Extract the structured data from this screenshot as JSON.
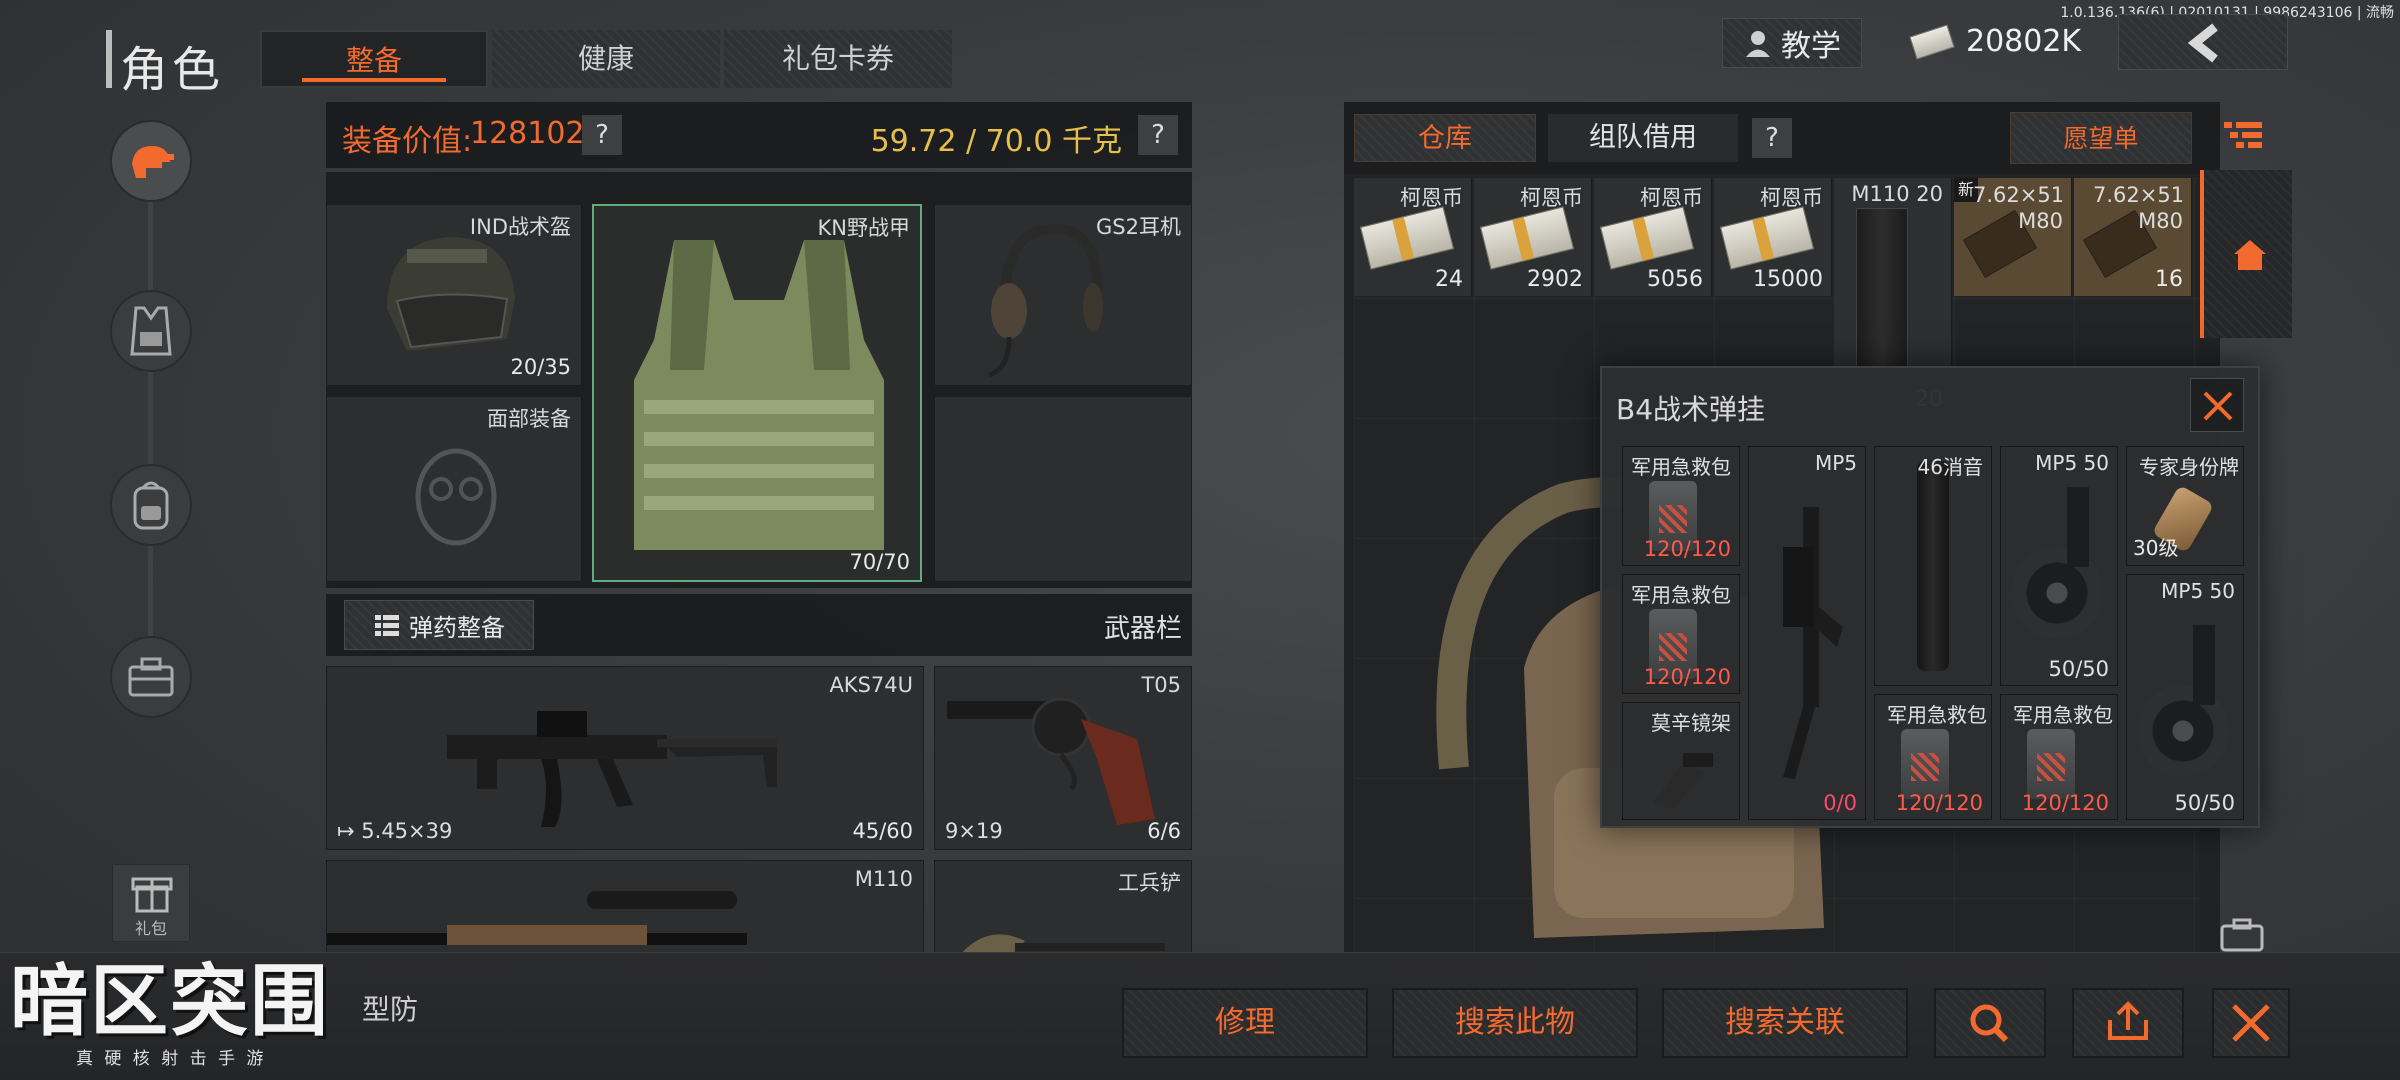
{
  "version": "1.0.136.136(6) | 02010131 | 9986243106 | 流畅",
  "header": {
    "title": "角色",
    "tabs": [
      "整备",
      "健康",
      "礼包卡券"
    ],
    "active_tab": 0,
    "tutorial_label": "教学",
    "currency": "20802K"
  },
  "equipment": {
    "value_label": "装备价值:",
    "value": "128102",
    "help": "?",
    "weight": "59.72 / 70.0 千克",
    "slots": [
      {
        "name": "IND战术盔",
        "count": "20/35"
      },
      {
        "name": "KN野战甲",
        "count": "70/70"
      },
      {
        "name": "GS2耳机",
        "count": ""
      },
      {
        "name": "面部装备",
        "count": ""
      }
    ],
    "ammo_button": "弹药整备",
    "weapons_label": "武器栏",
    "weapons": [
      {
        "name": "AKS74U",
        "ammo_type": "5.45×39",
        "count": "45/60"
      },
      {
        "name": "T05",
        "ammo_type": "9×19",
        "count": "6/6"
      },
      {
        "name": "M110",
        "ammo_type": "",
        "count": ""
      },
      {
        "name": "工兵铲",
        "ammo_type": "",
        "count": ""
      }
    ]
  },
  "storage": {
    "tabs": [
      "仓库",
      "组队借用"
    ],
    "help": "?",
    "wishlist": "愿望单",
    "items": [
      {
        "name": "柯恩币",
        "count": "24"
      },
      {
        "name": "柯恩币",
        "count": "2902"
      },
      {
        "name": "柯恩币",
        "count": "5056"
      },
      {
        "name": "柯恩币",
        "count": "15000"
      },
      {
        "name": "M110 20",
        "count": "20"
      },
      {
        "name": "7.62×51 M80",
        "count": "",
        "badge": "新"
      },
      {
        "name": "7.62×51 M80",
        "count": "16"
      }
    ]
  },
  "popup": {
    "title": "B4战术弹挂",
    "items": [
      {
        "name": "军用急救包",
        "value": "120/120"
      },
      {
        "name": "军用急救包",
        "value": "120/120"
      },
      {
        "name": "莫辛镜架",
        "value": ""
      },
      {
        "name": "MP5",
        "value": "0/0"
      },
      {
        "name": "46消音",
        "value": ""
      },
      {
        "name": "军用急救包",
        "value": "120/120"
      },
      {
        "name": "MP5 50",
        "value": "50/50"
      },
      {
        "name": "军用急救包",
        "value": "120/120"
      },
      {
        "name": "专家身份牌",
        "value": "30级"
      },
      {
        "name": "MP5 50",
        "value": "50/50"
      }
    ]
  },
  "bottom": {
    "repair": "修理",
    "search_item": "搜索此物",
    "search_related": "搜索关联",
    "partial_text": "型防",
    "gift_label": "礼包"
  },
  "logo": {
    "title": "暗区突围",
    "subtitle": "真 硬 核 射 击 手 游"
  },
  "colors": {
    "accent": "#f26a2e",
    "weight": "#e6c04a",
    "red": "#ff5a4a"
  }
}
